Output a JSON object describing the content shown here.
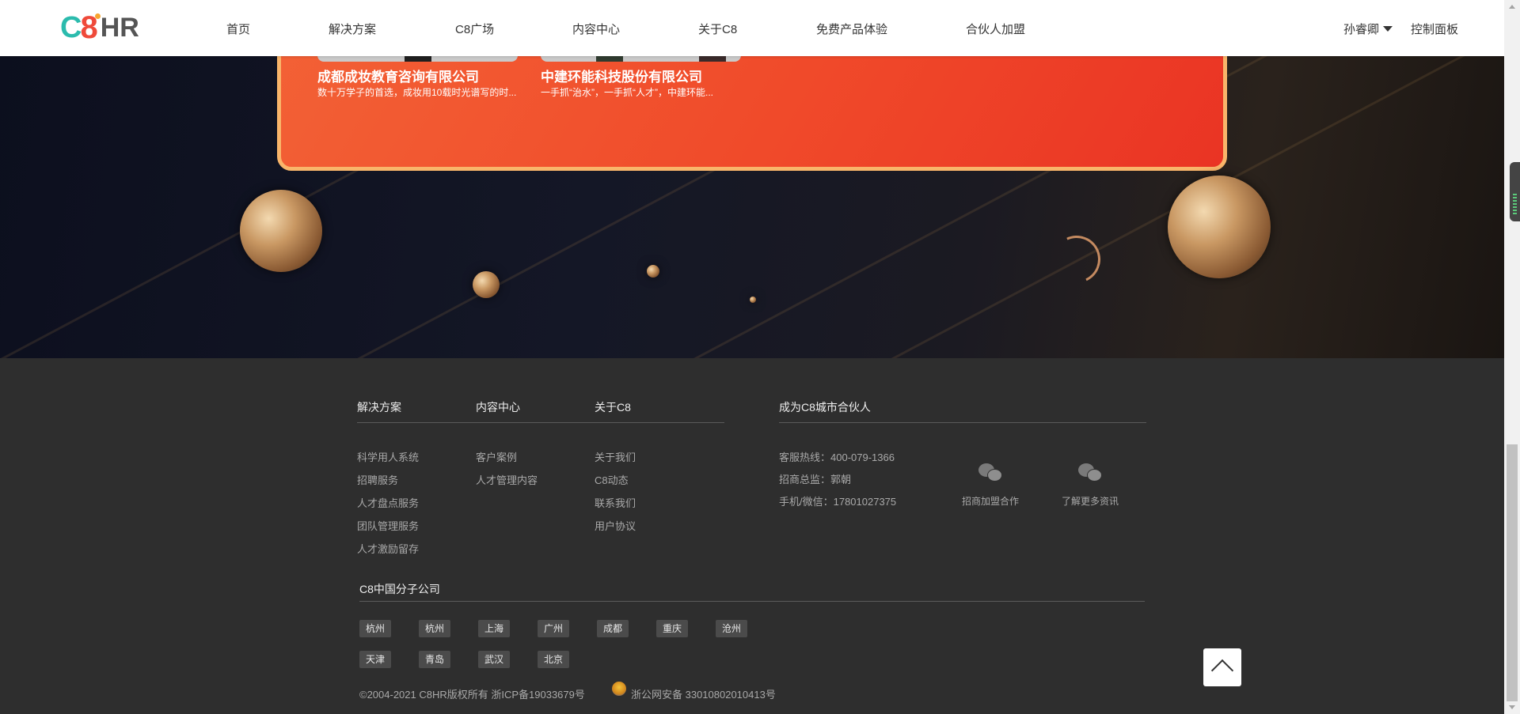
{
  "header": {
    "logo": {
      "c": "C",
      "eight": "8",
      "hr": "HR"
    },
    "nav": [
      {
        "label": "首页"
      },
      {
        "label": "解决方案"
      },
      {
        "label": "C8广场"
      },
      {
        "label": "内容中心"
      },
      {
        "label": "关于C8"
      },
      {
        "label": "免费产品体验"
      },
      {
        "label": "合伙人加盟"
      }
    ],
    "user_name": "孙睿卿",
    "user_caret_icon": "caret-down-icon",
    "control_panel": "控制面板"
  },
  "hero": {
    "cards": [
      {
        "title": "成都成妆教育咨询有限公司",
        "desc": "数十万学子的首选，成妆用10载时光谱写的时..."
      },
      {
        "title": "中建环能科技股份有限公司",
        "desc": "一手抓“治水”，一手抓“人才”，中建环能..."
      }
    ],
    "card_colors": {
      "start": "#f36236",
      "end": "#ea3424",
      "border": "#f9b56a"
    }
  },
  "footer": {
    "columns": [
      {
        "heading": "解决方案",
        "links": [
          "科学用人系统",
          "招聘服务",
          "人才盘点服务",
          "团队管理服务",
          "人才激励留存"
        ]
      },
      {
        "heading": "内容中心",
        "links": [
          "客户案例",
          "人才管理内容"
        ]
      },
      {
        "heading": "关于C8",
        "links": [
          "关于我们",
          "C8动态",
          "联系我们",
          "用户协议"
        ]
      }
    ],
    "partner": {
      "heading": "成为C8城市合伙人",
      "hotline": "客服热线：400-079-1366",
      "director": "招商总监：郭朝",
      "mobile": "手机/微信：17801027375",
      "qr": [
        {
          "icon": "wechat-icon",
          "label": "招商加盟合作"
        },
        {
          "icon": "wechat-icon",
          "label": "了解更多资讯"
        }
      ]
    },
    "branches": {
      "heading": "C8中国分子公司",
      "row1": [
        "杭州",
        "杭州",
        "上海",
        "广州",
        "成都",
        "重庆",
        "沧州"
      ],
      "row2": [
        "天津",
        "青岛",
        "武汉",
        "北京"
      ]
    },
    "copyright": "©2004-2021 C8HR版权所有 浙ICP备19033679号",
    "police_icon": "police-badge-icon",
    "police": "浙公网安备 33010802010413号",
    "back_to_top_icon": "chevron-up-icon"
  }
}
